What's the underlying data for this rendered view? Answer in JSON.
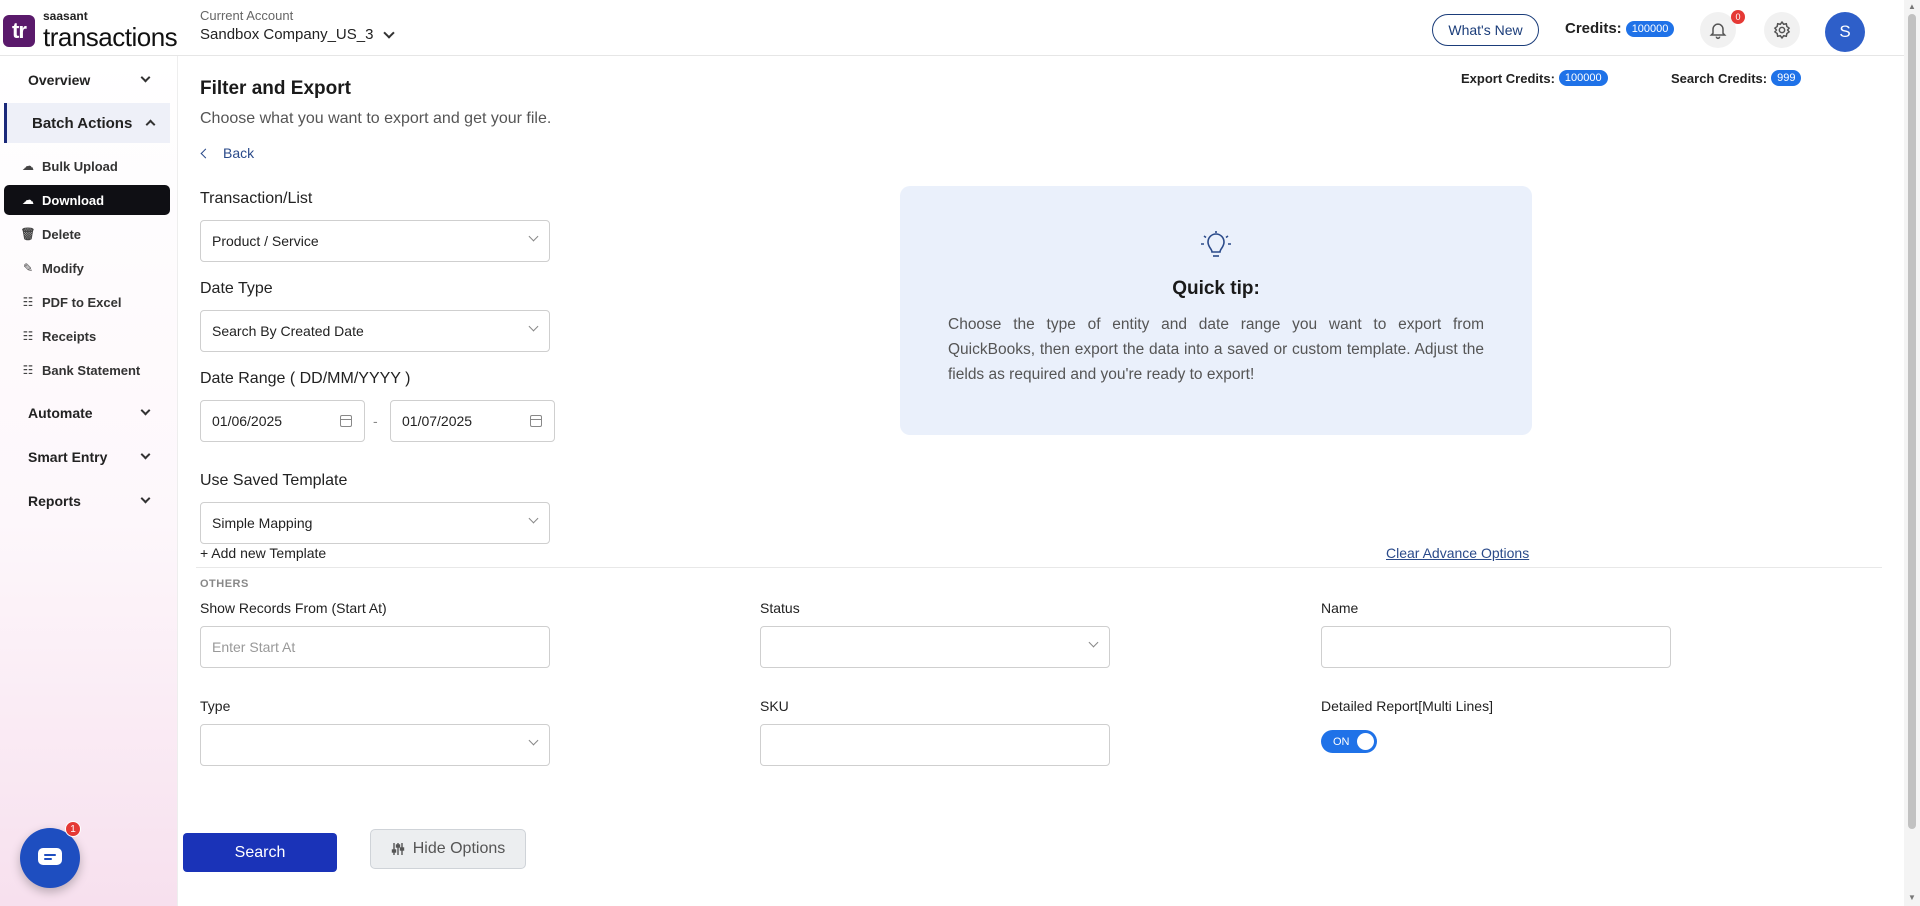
{
  "header": {
    "logo_mark": "tr",
    "logo_small": "saasant",
    "logo_big": "transactions",
    "account_label": "Current Account",
    "account_name": "Sandbox Company_US_3",
    "whats_new": "What's New",
    "credits_label": "Credits:",
    "credits_value": "100000",
    "notifications_count": "0",
    "avatar_initial": "S"
  },
  "sidebar": {
    "groups": {
      "overview": "Overview",
      "batch_actions": "Batch Actions",
      "automate": "Automate",
      "smart_entry": "Smart Entry",
      "reports": "Reports"
    },
    "items": [
      {
        "label": "Bulk Upload",
        "icon": "cloud-upload-icon"
      },
      {
        "label": "Download",
        "icon": "cloud-download-icon"
      },
      {
        "label": "Delete",
        "icon": "trash-icon"
      },
      {
        "label": "Modify",
        "icon": "edit-icon"
      },
      {
        "label": "PDF to Excel",
        "icon": "file-icon"
      },
      {
        "label": "Receipts",
        "icon": "receipt-icon"
      },
      {
        "label": "Bank Statement",
        "icon": "bank-icon"
      }
    ],
    "chat_badge": "1"
  },
  "main": {
    "title": "Filter and Export",
    "subtitle": "Choose what you want to export and get your file.",
    "back": "Back",
    "export_credits_label": "Export Credits:",
    "export_credits_value": "100000",
    "search_credits_label": "Search Credits:",
    "search_credits_value": "999",
    "transaction_label": "Transaction/List",
    "transaction_value": "Product / Service",
    "date_type_label": "Date Type",
    "date_type_value": "Search By Created Date",
    "date_range_label": "Date Range ( DD/MM/YYYY )",
    "date_from": "01/06/2025",
    "date_separator": "-",
    "date_to": "01/07/2025",
    "template_label": "Use Saved Template",
    "template_value": "Simple Mapping",
    "add_template": "+ Add new Template",
    "clear_advance": "Clear Advance Options",
    "others_label": "OTHERS",
    "start_at_label": "Show Records From (Start At)",
    "start_at_placeholder": "Enter Start At",
    "status_label": "Status",
    "name_label": "Name",
    "type_label": "Type",
    "sku_label": "SKU",
    "detailed_label": "Detailed Report[Multi Lines]",
    "toggle_state": "ON",
    "search_button": "Search",
    "hide_options": "Hide Options"
  },
  "tip": {
    "title": "Quick tip:",
    "text": "Choose the type of entity and date range you want to export from QuickBooks, then export the data into a saved or custom template. Adjust the fields as required and you're ready to export!"
  }
}
